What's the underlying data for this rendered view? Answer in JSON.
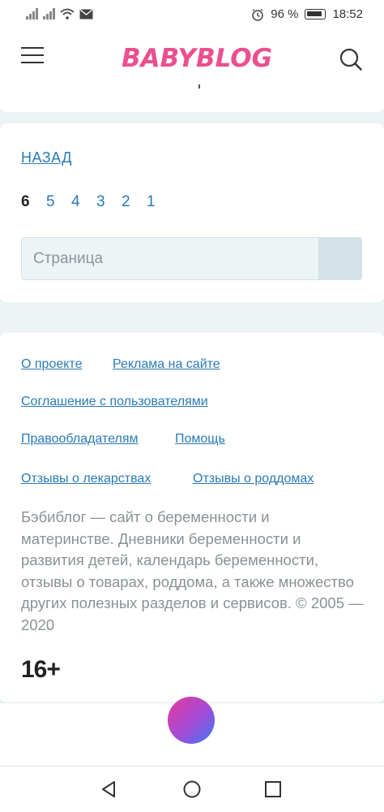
{
  "status_bar": {
    "battery": "96 %",
    "time": "18:52"
  },
  "header": {
    "logo": "BABYBLOG",
    "menu_icon": "hamburger-icon",
    "search_icon": "search-icon"
  },
  "pagination": {
    "back_label": "НАЗАД",
    "current_page": "6",
    "pages": [
      "5",
      "4",
      "3",
      "2",
      "1"
    ],
    "input_placeholder": "Страница"
  },
  "footer": {
    "links": {
      "about": "О проекте",
      "ads": "Реклама на сайте",
      "agreement": "Соглашение с пользователями",
      "rights": "Правообладателям",
      "help": "Помощь",
      "drug_reviews": "Отзывы о лекарствах",
      "maternity_reviews": "Отзывы о роддомах"
    },
    "about_text": "Бэбиблог — сайт о беременности и материнстве. Дневники беременности и развития детей, календарь беременности, отзывы о товарах, роддома, а также множество других полезных разделов и сервисов. © 2005 — 2020",
    "age_rating": "16+"
  },
  "colors": {
    "logo": "#ec4f8e",
    "link": "#2a7ab8",
    "background": "#edf3f5"
  }
}
